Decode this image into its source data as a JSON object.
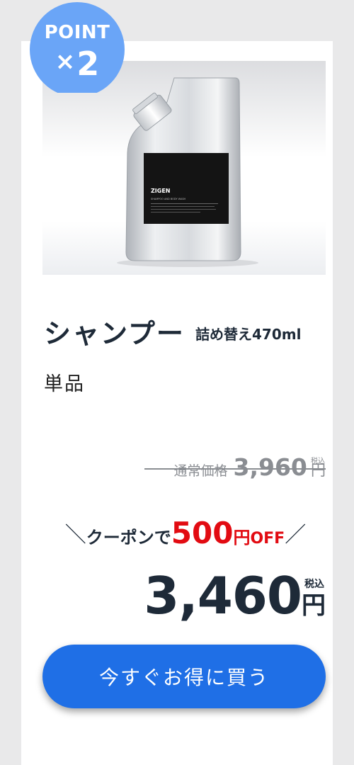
{
  "badge": {
    "label": "POINT",
    "multiplier_symbol": "×",
    "multiplier_value": "2",
    "color": "#6aa5f7"
  },
  "product": {
    "image_brand": "ZIGEN",
    "image_line": "SHAMPOO AND BODY WASH",
    "title": "シャンプー",
    "variant": "詰め替え470ml",
    "subtitle": "単品"
  },
  "pricing": {
    "regular_label": "通常価格",
    "regular_price": "3,960",
    "regular_currency": "円",
    "regular_tax_label": "税込",
    "coupon_prefix": "＼",
    "coupon_text": "クーポンで",
    "coupon_amount": "500",
    "coupon_currency": "円",
    "coupon_off": "OFF",
    "coupon_suffix": "／",
    "sale_price": "3,460",
    "sale_currency": "円",
    "sale_tax_label": "税込"
  },
  "cta": {
    "label": "今すぐお得に買う"
  },
  "colors": {
    "accent": "#1f6fe6",
    "discount": "#e20b12",
    "text_dark": "#1e2a38",
    "muted": "#8a8d92"
  }
}
